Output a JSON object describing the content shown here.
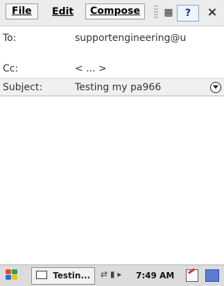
{
  "menu": {
    "file": "File",
    "edit": "Edit",
    "compose": "Compose"
  },
  "header": {
    "to_label": "To:",
    "to_value": "supportengineering@u",
    "cc_label": "Cc:",
    "cc_value": "< ... >",
    "subject_label": "Subject:",
    "subject_value": "Testing my pa966"
  },
  "taskbar": {
    "task_label": "Testin...",
    "time": "7:49 AM"
  },
  "icons": {
    "help": "?",
    "close": "×"
  }
}
